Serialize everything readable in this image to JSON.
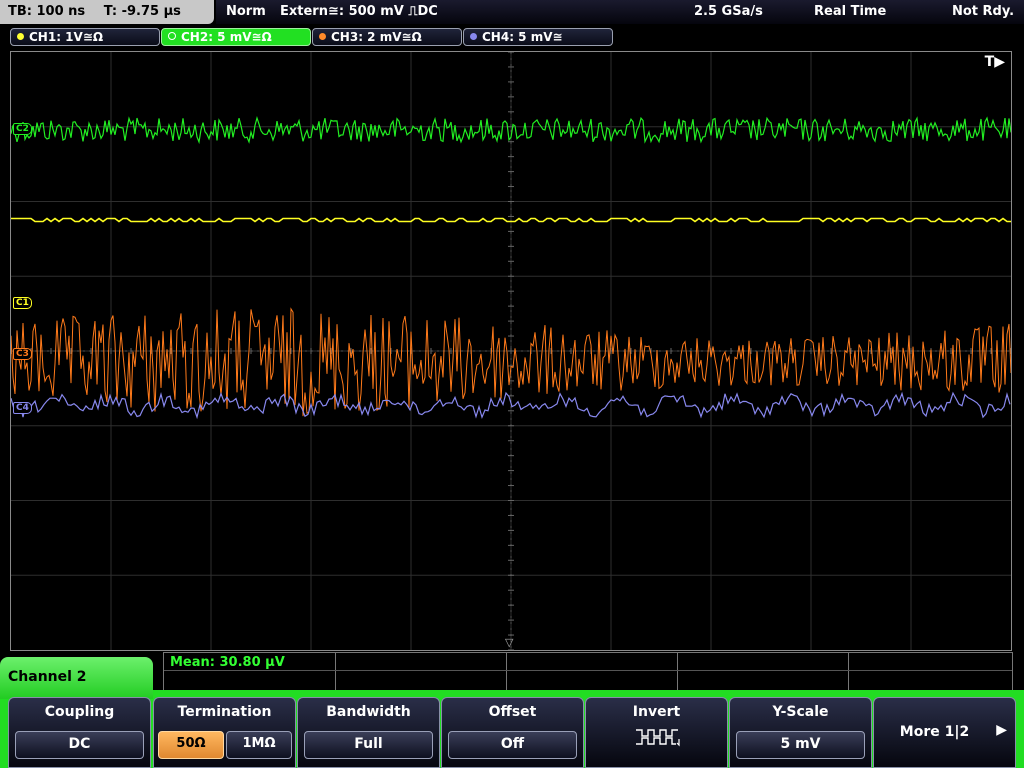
{
  "status": {
    "timebase": "TB: 100 ns",
    "trigger_time": "T: -9.75 µs",
    "mode": "Norm",
    "trigger_source": "Extern≅: 500 mV ⎍DC",
    "sample_rate": "2.5 GSa/s",
    "acquisition": "Real Time",
    "state": "Not Rdy."
  },
  "channels": [
    {
      "label": "CH1: 1V≅Ω",
      "color": "#ffff33"
    },
    {
      "label": "CH2: 5 mV≅Ω",
      "color": "#33ff33",
      "active": true
    },
    {
      "label": "CH3: 2 mV≅Ω",
      "color": "#ff8a2a"
    },
    {
      "label": "CH4: 5 mV≅",
      "color": "#8888ee"
    }
  ],
  "display": {
    "trigger_marker": "T▶",
    "markers": [
      "C1",
      "C2",
      "C3",
      "C4"
    ],
    "trigger_position_mark": "▽"
  },
  "measurement": {
    "mean": "Mean: 30.80 µV"
  },
  "menu": {
    "title": "Channel 2",
    "coupling_label": "Coupling",
    "coupling_value": "DC",
    "termination_label": "Termination",
    "termination_options": [
      "50Ω",
      "1MΩ"
    ],
    "termination_selected": "50Ω",
    "bandwidth_label": "Bandwidth",
    "bandwidth_value": "Full",
    "offset_label": "Offset",
    "offset_value": "Off",
    "invert_label": "Invert",
    "invert_icon": "invert-waveform-icon",
    "yscale_label": "Y-Scale",
    "yscale_value": "5 mV",
    "more_label": "More 1|2"
  }
}
